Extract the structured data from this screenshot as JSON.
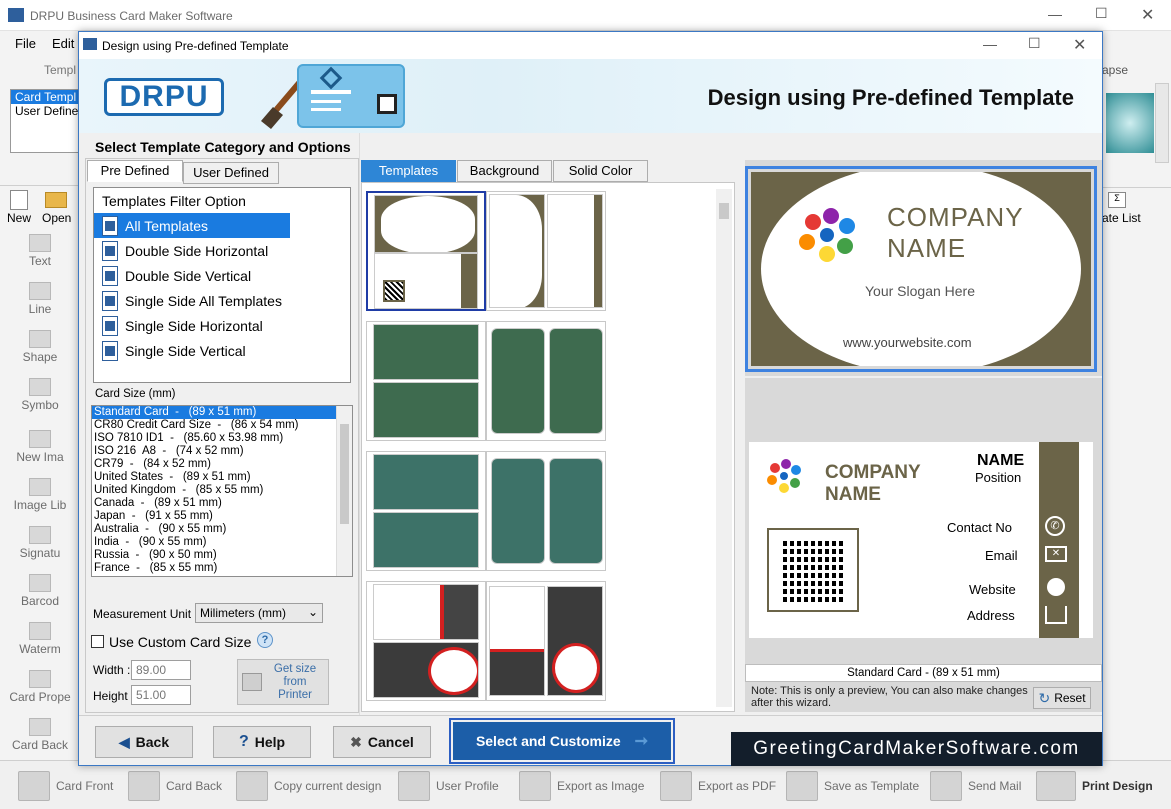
{
  "app": {
    "title": "DRPU Business Card Maker Software",
    "menu": [
      "File",
      "Edit"
    ],
    "ribbon_group": "Templ",
    "ribbon_right_label": "apse",
    "template_list": [
      "Card Templ",
      "User Define"
    ],
    "toolbar": {
      "new": "New",
      "open": "Open",
      "list": "ate List"
    },
    "left_tools": [
      "Text",
      "Line",
      "Shape",
      "Symbo",
      "New Ima",
      "Image Lib",
      "Signatu",
      "Barcod",
      "Waterm",
      "Card Prope",
      "Card Back"
    ],
    "bottom_buttons": [
      "Card Front",
      "Card Back",
      "Copy current design",
      "User Profile",
      "Export as Image",
      "Export as PDF",
      "Save as Template",
      "Send Mail",
      "Print Design"
    ]
  },
  "dialog": {
    "title": "Design using Pre-defined Template",
    "logo_text": "DRPU",
    "banner_title": "Design using Pre-defined Template",
    "section_title": "Select Template Category and Options",
    "tabs": [
      "Pre Defined",
      "User Defined"
    ],
    "filter_header": "Templates Filter Option",
    "filters": [
      "All Templates",
      "Double Side Horizontal",
      "Double Side Vertical",
      "Single Side All Templates",
      "Single Side Horizontal",
      "Single Side Vertical"
    ],
    "card_size_label": "Card Size (mm)",
    "card_sizes": [
      "Standard Card  -   (89 x 51 mm)",
      "CR80 Credit Card Size  -   (86 x 54 mm)",
      "ISO 7810 ID1  -   (85.60 x 53.98 mm)",
      "ISO 216  A8  -   (74 x 52 mm)",
      "CR79  -   (84 x 52 mm)",
      "United States  -   (89 x 51 mm)",
      "United Kingdom  -   (85 x 55 mm)",
      "Canada  -   (89 x 51 mm)",
      "Japan  -   (91 x 55 mm)",
      "Australia  -   (90 x 55 mm)",
      "India  -   (90 x 55 mm)",
      "Russia  -   (90 x 50 mm)",
      "France  -   (85 x 55 mm)"
    ],
    "measurement_label": "Measurement Unit :",
    "measurement_value": "Milimeters (mm)",
    "custom_size_label": "Use Custom Card Size",
    "width_label": "Width :",
    "width_value": "89.00",
    "height_label": "Height :",
    "height_value": "51.00",
    "get_size_button": "Get size from Printer",
    "template_tabs": [
      "Templates",
      "Background",
      "Solid Color"
    ],
    "preview_size": "Standard Card  -   (89 x 51 mm)",
    "note": "Note: This is only a preview, You can also make changes after this wizard.",
    "reset": "Reset",
    "back": "Back",
    "help": "Help",
    "cancel": "Cancel",
    "select": "Select and Customize",
    "watermark": "GreetingCardMakerSoftware.com"
  },
  "card_front": {
    "company1": "COMPANY",
    "company2": "NAME",
    "slogan": "Your Slogan Here",
    "website": "www.yourwebsite.com"
  },
  "card_back": {
    "company1": "COMPANY",
    "company2": "NAME",
    "name": "NAME",
    "position": "Position",
    "contact": "Contact  No",
    "email": "Email",
    "website": "Website",
    "address": "Address"
  },
  "colors": {
    "accent": "#1a7be0",
    "card_olive": "#6b6448",
    "green": "#3e6b4f",
    "teal": "#3d7268",
    "select_btn": "#1c5ea8"
  }
}
